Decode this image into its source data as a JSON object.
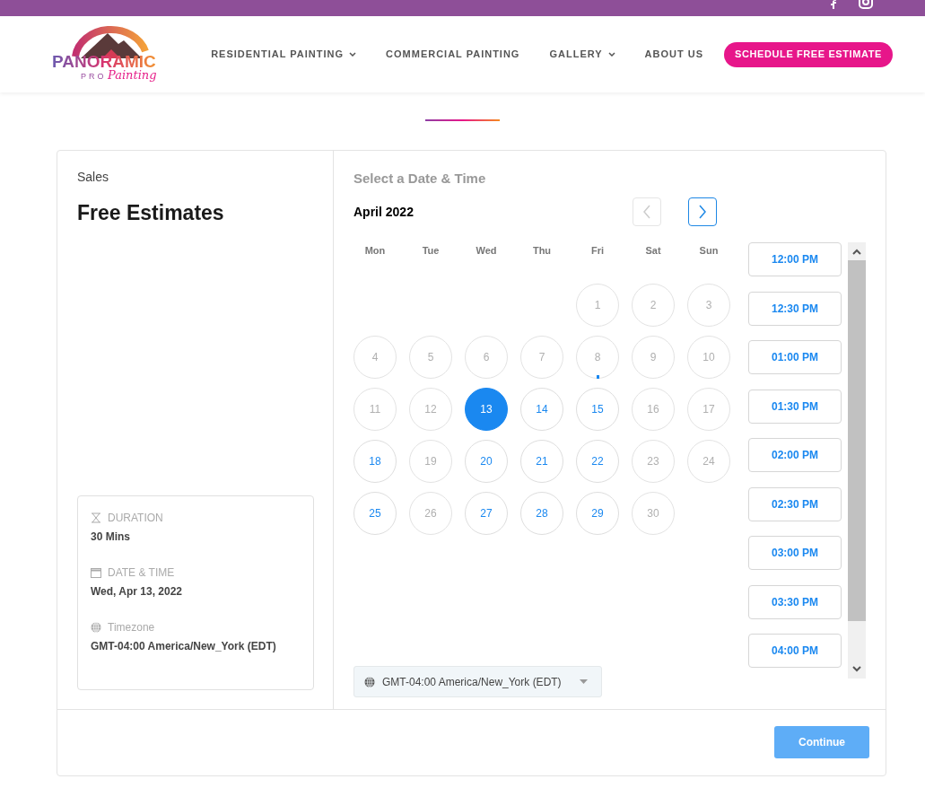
{
  "logo": {
    "main": "PANORAMIC",
    "sub": "PRO",
    "script": "Painting"
  },
  "nav": [
    {
      "label": "RESIDENTIAL PAINTING",
      "dropdown": true
    },
    {
      "label": "COMMERCIAL PAINTING",
      "dropdown": false
    },
    {
      "label": "GALLERY",
      "dropdown": true
    },
    {
      "label": "ABOUT US",
      "dropdown": false
    }
  ],
  "cta": "SCHEDULE FREE ESTIMATE",
  "event": {
    "category": "Sales",
    "title": "Free Estimates"
  },
  "summary": [
    {
      "kind": "duration",
      "label": "DURATION",
      "value": "30 Mins"
    },
    {
      "kind": "date",
      "label": "DATE & TIME",
      "value": "Wed, Apr 13, 2022"
    },
    {
      "kind": "timezone",
      "label": "Timezone",
      "value": "GMT-04:00 America/New_York (EDT)"
    }
  ],
  "heading": "Select a Date & Time",
  "month": "April 2022",
  "prev_enabled": false,
  "next_enabled": true,
  "weekdays": [
    "Mon",
    "Tue",
    "Wed",
    "Thu",
    "Fri",
    "Sat",
    "Sun"
  ],
  "weeks": [
    [
      {
        "kind": "blank"
      },
      {
        "kind": "blank"
      },
      {
        "kind": "blank"
      },
      {
        "kind": "blank"
      },
      {
        "day": "1",
        "available": false,
        "selected": false,
        "today": false
      },
      {
        "day": "2",
        "available": false,
        "selected": false,
        "today": false
      },
      {
        "day": "3",
        "available": false,
        "selected": false,
        "today": false
      }
    ],
    [
      {
        "day": "4",
        "available": false,
        "selected": false,
        "today": false
      },
      {
        "day": "5",
        "available": false,
        "selected": false,
        "today": false
      },
      {
        "day": "6",
        "available": false,
        "selected": false,
        "today": false
      },
      {
        "day": "7",
        "available": false,
        "selected": false,
        "today": false
      },
      {
        "day": "8",
        "available": false,
        "selected": false,
        "today": true
      },
      {
        "day": "9",
        "available": false,
        "selected": false,
        "today": false
      },
      {
        "day": "10",
        "available": false,
        "selected": false,
        "today": false
      }
    ],
    [
      {
        "day": "11",
        "available": false,
        "selected": false,
        "today": false
      },
      {
        "day": "12",
        "available": false,
        "selected": false,
        "today": false
      },
      {
        "day": "13",
        "available": true,
        "selected": true,
        "today": false
      },
      {
        "day": "14",
        "available": true,
        "selected": false,
        "today": false
      },
      {
        "day": "15",
        "available": true,
        "selected": false,
        "today": false
      },
      {
        "day": "16",
        "available": false,
        "selected": false,
        "today": false
      },
      {
        "day": "17",
        "available": false,
        "selected": false,
        "today": false
      }
    ],
    [
      {
        "day": "18",
        "available": true,
        "selected": false,
        "today": false
      },
      {
        "day": "19",
        "available": false,
        "selected": false,
        "today": false
      },
      {
        "day": "20",
        "available": true,
        "selected": false,
        "today": false
      },
      {
        "day": "21",
        "available": true,
        "selected": false,
        "today": false
      },
      {
        "day": "22",
        "available": true,
        "selected": false,
        "today": false
      },
      {
        "day": "23",
        "available": false,
        "selected": false,
        "today": false
      },
      {
        "day": "24",
        "available": false,
        "selected": false,
        "today": false
      }
    ],
    [
      {
        "day": "25",
        "available": true,
        "selected": false,
        "today": false
      },
      {
        "day": "26",
        "available": false,
        "selected": false,
        "today": false
      },
      {
        "day": "27",
        "available": true,
        "selected": false,
        "today": false
      },
      {
        "day": "28",
        "available": true,
        "selected": false,
        "today": false
      },
      {
        "day": "29",
        "available": true,
        "selected": false,
        "today": false
      },
      {
        "day": "30",
        "available": false,
        "selected": false,
        "today": false
      }
    ]
  ],
  "times": [
    "12:00 PM",
    "12:30 PM",
    "01:00 PM",
    "01:30 PM",
    "02:00 PM",
    "02:30 PM",
    "03:00 PM",
    "03:30 PM",
    "04:00 PM"
  ],
  "timezone_select": "GMT-04:00 America/New_York (EDT)",
  "continue": "Continue"
}
